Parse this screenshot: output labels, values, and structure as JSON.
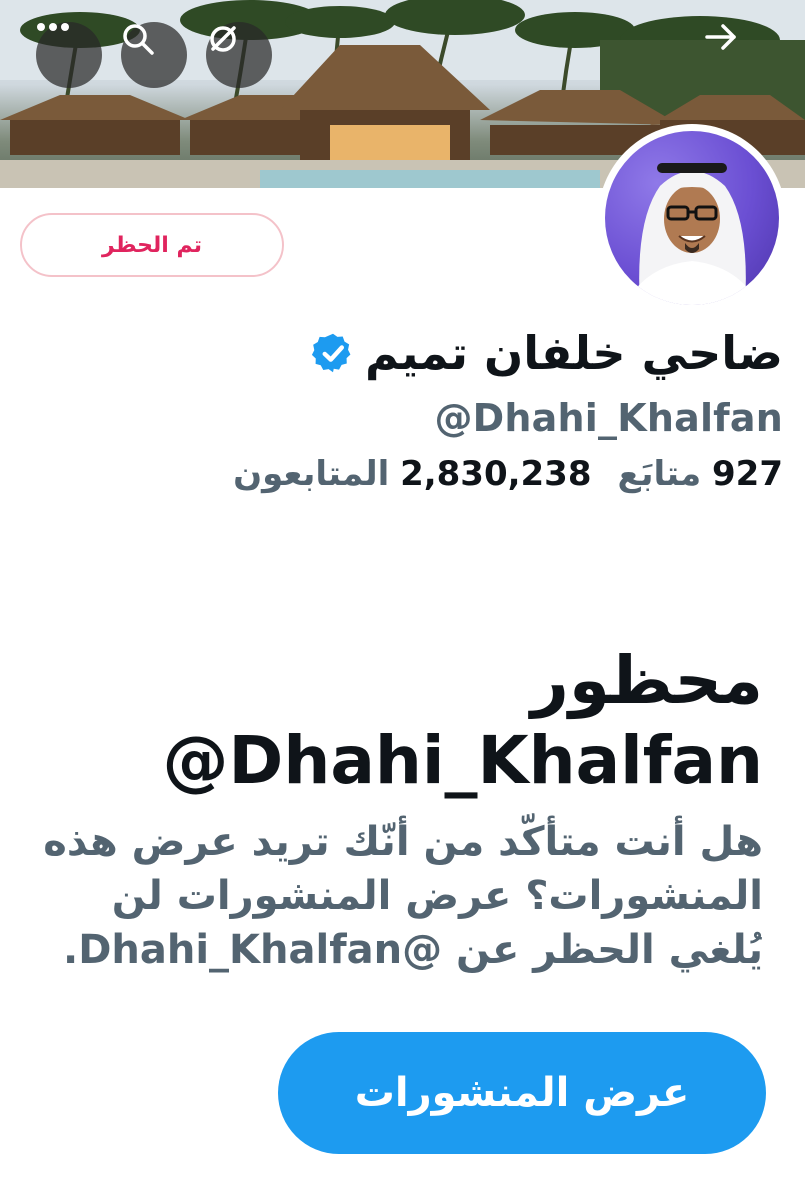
{
  "header": {
    "back_icon": "arrow-right-icon",
    "search_icon": "search-icon",
    "more_icon": "more-horizontal-icon",
    "hide_icon": "slash-circle-icon"
  },
  "profile": {
    "blocked_label": "تم الحظر",
    "name": "ضاحي خلفان تميم",
    "handle": "@Dhahi_Khalfan",
    "following_count": "927",
    "following_label": "متابَع",
    "followers_count": "2,830,238",
    "followers_label": "المتابعون"
  },
  "blocked_notice": {
    "title_line1": "محظور",
    "title_line2": "@Dhahi_Khalfan",
    "description": "هل أنت متأكّد من أنّك تريد عرض هذه المنشورات؟ عرض المنشورات لن يُلغي الحظر عن @Dhahi_Khalfan.",
    "view_posts_label": "عرض المنشورات"
  },
  "colors": {
    "accent": "#1d9bf0",
    "blocked_text": "#e0245e",
    "secondary_text": "#536471"
  }
}
